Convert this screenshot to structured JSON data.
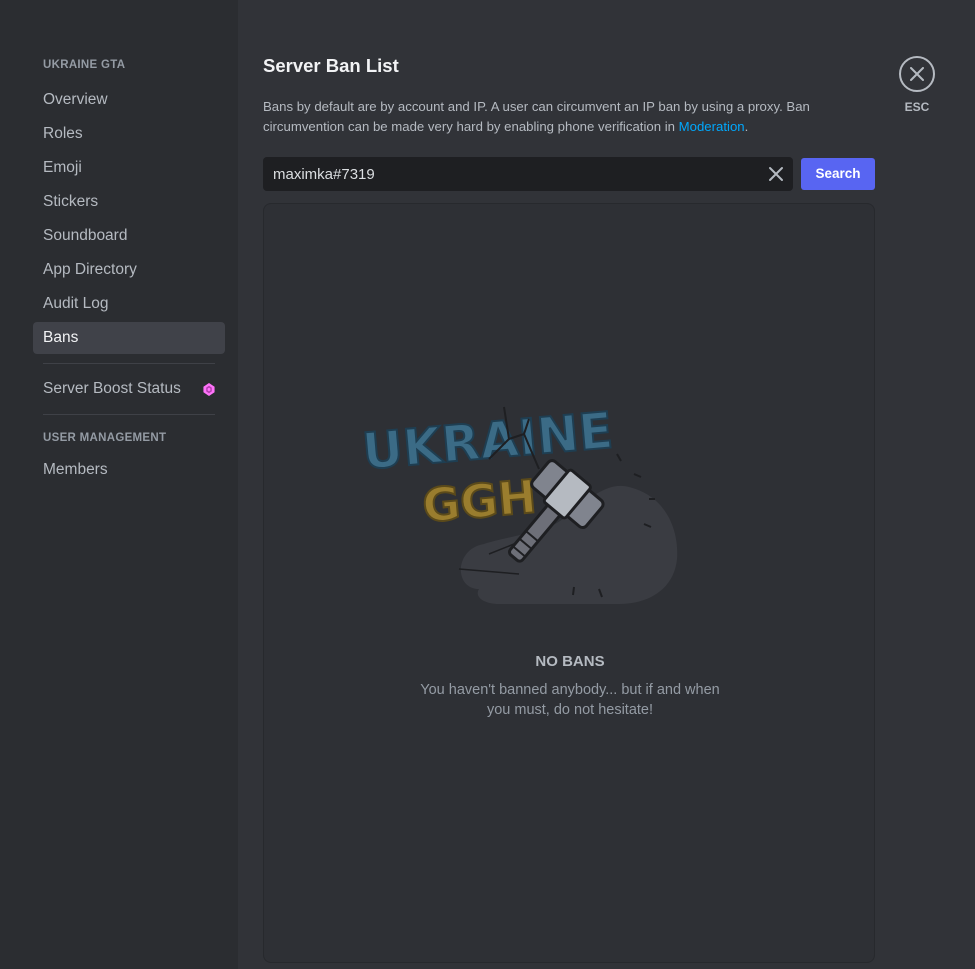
{
  "sidebar": {
    "server_section": "UKRAINE GTA",
    "items": [
      {
        "label": "Overview"
      },
      {
        "label": "Roles"
      },
      {
        "label": "Emoji"
      },
      {
        "label": "Stickers"
      },
      {
        "label": "Soundboard"
      },
      {
        "label": "App Directory"
      },
      {
        "label": "Audit Log"
      },
      {
        "label": "Bans",
        "selected": true
      }
    ],
    "boost_label": "Server Boost Status",
    "user_section": "USER MANAGEMENT",
    "members_label": "Members"
  },
  "main": {
    "title": "Server Ban List",
    "description_prefix": "Bans by default are by account and IP. A user can circumvent an IP ban by using a proxy. Ban circumvention can be made very hard by enabling phone verification in ",
    "description_link": "Moderation",
    "description_suffix": ".",
    "search": {
      "value": "maximka#7319",
      "button_label": "Search"
    },
    "empty_state": {
      "logo_text_top": "UKRAINE",
      "logo_text_bottom": "GGH",
      "title": "NO BANS",
      "body": "You haven't banned anybody... but if and when you must, do not hesitate!"
    }
  },
  "close": {
    "label": "ESC"
  },
  "colors": {
    "accent": "#5865f2",
    "link": "#00a8fc",
    "boost_gem": "#ff73fa"
  }
}
